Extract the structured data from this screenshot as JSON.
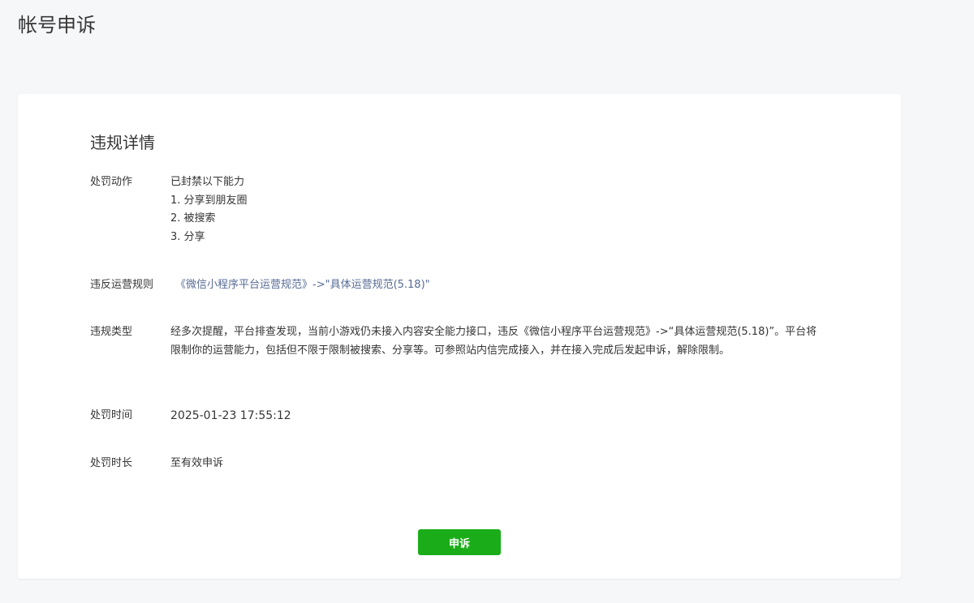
{
  "page": {
    "title": "帐号申诉"
  },
  "details": {
    "section_title": "违规详情",
    "penalty_action": {
      "label": "处罚动作",
      "lines": [
        "已封禁以下能力",
        "1. 分享到朋友圈",
        "2. 被搜索",
        "3. 分享"
      ]
    },
    "violated_rule": {
      "label": "违反运营规则",
      "link_text": "《微信小程序平台运营规范》->\"具体运营规范(5.18)\""
    },
    "violation_type": {
      "label": "违规类型",
      "text": "经多次提醒，平台排查发现，当前小游戏仍未接入内容安全能力接口，违反《微信小程序平台运营规范》->“具体运营规范(5.18)”。平台将限制你的运营能力，包括但不限于限制被搜索、分享等。可参照站内信完成接入，并在接入完成后发起申诉，解除限制。"
    },
    "penalty_time": {
      "label": "处罚时间",
      "value": "2025-01-23 17:55:12"
    },
    "penalty_duration": {
      "label": "处罚时长",
      "value": "至有效申诉"
    }
  },
  "actions": {
    "appeal_label": "申诉"
  },
  "colors": {
    "primary_green": "#1aad19",
    "link_blue": "#576b95",
    "background": "#f6f7f9"
  }
}
